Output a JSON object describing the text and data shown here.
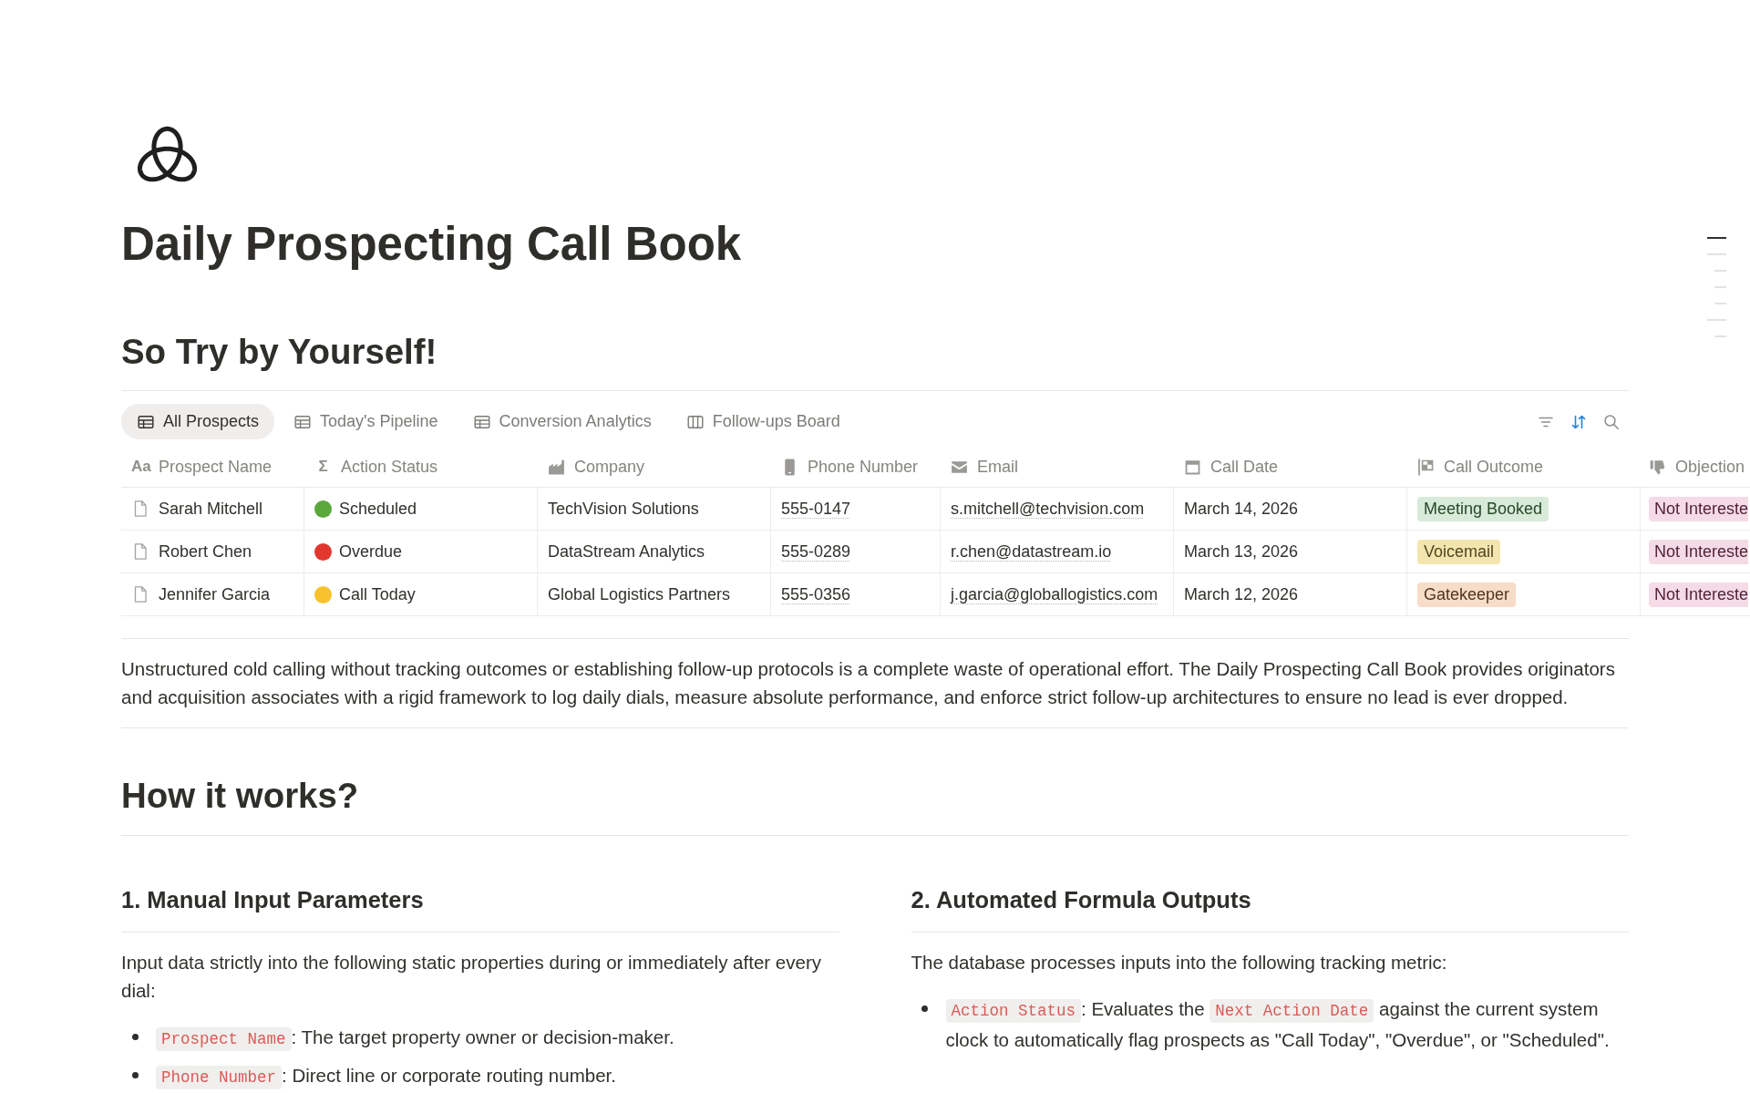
{
  "page": {
    "title": "Daily Prospecting Call Book",
    "outline_marks": [
      {
        "kind": "major",
        "selected": true
      },
      {
        "kind": "major",
        "selected": false
      },
      {
        "kind": "minor",
        "selected": false
      },
      {
        "kind": "minor",
        "selected": false
      },
      {
        "kind": "minor",
        "selected": false
      },
      {
        "kind": "major",
        "selected": false
      },
      {
        "kind": "minor",
        "selected": false
      }
    ]
  },
  "try_section": {
    "heading": "So Try by Yourself!"
  },
  "database": {
    "tabs": [
      {
        "label": "All Prospects",
        "kind": "table",
        "selected": true
      },
      {
        "label": "Today's Pipeline",
        "kind": "table",
        "selected": false
      },
      {
        "label": "Conversion Analytics",
        "kind": "table",
        "selected": false
      },
      {
        "label": "Follow-ups Board",
        "kind": "board",
        "selected": false
      }
    ],
    "toolbar": [
      {
        "kind": "filter",
        "active": false
      },
      {
        "kind": "sort",
        "active": true
      },
      {
        "kind": "search",
        "active": false
      }
    ],
    "columns": [
      {
        "label": "Prospect Name",
        "kind": "title",
        "glyph": "Aa"
      },
      {
        "label": "Action Status",
        "kind": "formula",
        "glyph": "Σ"
      },
      {
        "label": "Company",
        "kind": "company"
      },
      {
        "label": "Phone Number",
        "kind": "phone"
      },
      {
        "label": "Email",
        "kind": "email"
      },
      {
        "label": "Call Date",
        "kind": "date"
      },
      {
        "label": "Call Outcome",
        "kind": "outcome"
      },
      {
        "label": "Objection",
        "kind": "objection"
      }
    ],
    "rows": [
      {
        "cells": [
          {
            "text": "Sarah Mitchell"
          },
          {
            "text": "Scheduled",
            "color": "#5aa83c"
          },
          {
            "text": "TechVision Solutions"
          },
          {
            "text": "555-0147"
          },
          {
            "text": "s.mitchell@techvision.com"
          },
          {
            "text": "March 14, 2026"
          },
          {
            "text": "Meeting Booked",
            "color": "#d8ead9"
          },
          {
            "text": "Not Intereste",
            "color": "#f4dbe6"
          }
        ]
      },
      {
        "cells": [
          {
            "text": "Robert Chen"
          },
          {
            "text": "Overdue",
            "color": "#e2372f"
          },
          {
            "text": "DataStream Analytics"
          },
          {
            "text": "555-0289"
          },
          {
            "text": "r.chen@datastream.io"
          },
          {
            "text": "March 13, 2026"
          },
          {
            "text": "Voicemail",
            "color": "#f4e5ae"
          },
          {
            "text": "Not Intereste",
            "color": "#f4dbe6"
          }
        ]
      },
      {
        "cells": [
          {
            "text": "Jennifer Garcia"
          },
          {
            "text": "Call Today",
            "color": "#f8c22c"
          },
          {
            "text": "Global Logistics Partners"
          },
          {
            "text": "555-0356"
          },
          {
            "text": "j.garcia@globallogistics.com"
          },
          {
            "text": "March 12, 2026"
          },
          {
            "text": "Gatekeeper",
            "color": "#f7dcc8"
          },
          {
            "text": "Not Intereste",
            "color": "#f4dbe6"
          }
        ]
      }
    ]
  },
  "description": "Unstructured cold calling without tracking outcomes or establishing follow-up protocols is a complete waste of operational effort. The Daily Prospecting Call Book provides originators and acquisition associates with a rigid framework to log daily dials, measure absolute performance, and enforce strict follow-up architectures to ensure no lead is ever dropped.",
  "how_it_works": {
    "heading": "How it works?",
    "columns": [
      {
        "heading": "1. Manual Input Parameters",
        "intro": "Input data strictly into the following static properties during or immediately after every dial:",
        "bullets": [
          {
            "parts": [
              {
                "kind": "code",
                "text": "Prospect Name"
              },
              {
                "kind": "plain",
                "text": ": The target property owner or decision-maker."
              }
            ]
          },
          {
            "parts": [
              {
                "kind": "code",
                "text": "Phone Number"
              },
              {
                "kind": "plain",
                "text": ": Direct line or corporate routing number."
              }
            ]
          }
        ]
      },
      {
        "heading": "2. Automated Formula Outputs",
        "intro": "The database processes inputs into the following tracking metric:",
        "bullets": [
          {
            "parts": [
              {
                "kind": "code",
                "text": "Action Status"
              },
              {
                "kind": "plain",
                "text": ": Evaluates the "
              },
              {
                "kind": "code",
                "text": "Next Action Date"
              },
              {
                "kind": "plain",
                "text": " against the current system clock to automatically flag prospects as \"Call Today\", \"Overdue\", or \"Scheduled\"."
              }
            ]
          }
        ]
      }
    ]
  }
}
